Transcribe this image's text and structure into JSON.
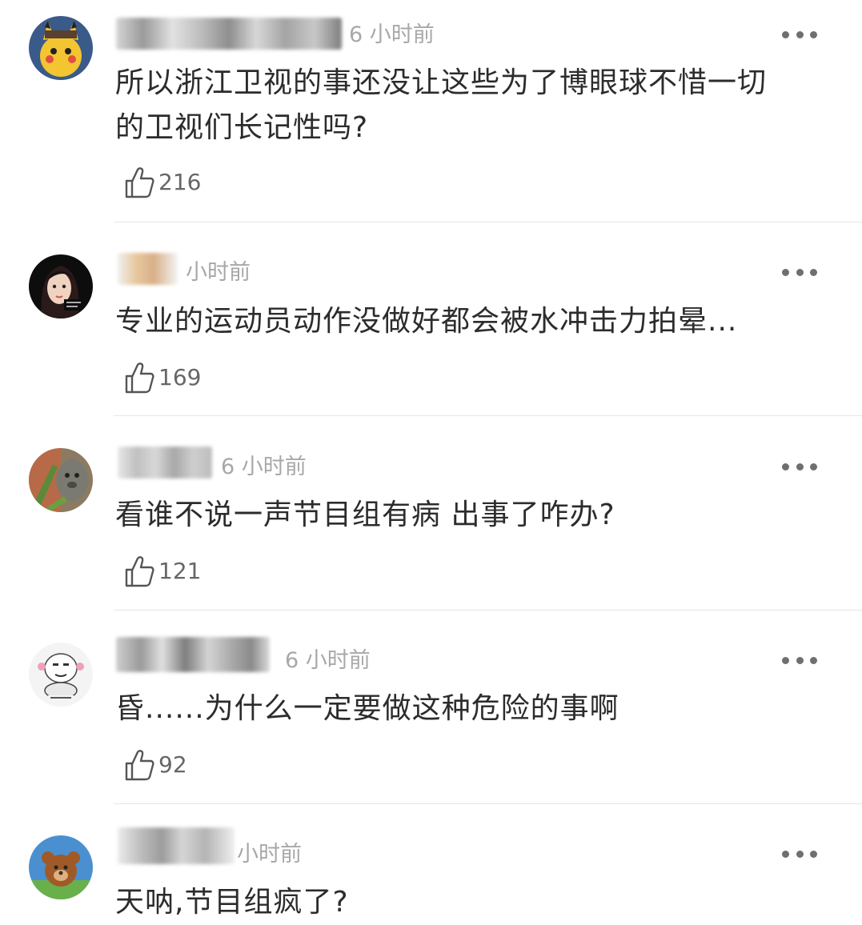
{
  "comments": [
    {
      "time": "6 小时前",
      "text_lines": [
        "所以浙江卫视的事还没让这些为了博眼球不惜一切",
        "的卫视们长记性吗?"
      ],
      "likes": "216"
    },
    {
      "time": "小时前",
      "text_lines": [
        "专业的运动员动作没做好都会被水冲击力拍晕..."
      ],
      "likes": "169"
    },
    {
      "time": "6 小时前",
      "text_lines": [
        "看谁不说一声节目组有病 出事了咋办?"
      ],
      "likes": "121"
    },
    {
      "time": "6 小时前",
      "text_lines": [
        "昏......为什么一定要做这种危险的事啊"
      ],
      "likes": "92"
    },
    {
      "time": "小时前",
      "text_lines": [
        "天呐,节目组疯了?"
      ],
      "likes": ""
    }
  ],
  "icons": {
    "like": "thumbs-up-icon",
    "more": "more-dots-icon"
  },
  "colors": {
    "timestamp": "#a8a8a8",
    "divider": "#e6e6e6",
    "text": "#2c2c2c"
  }
}
